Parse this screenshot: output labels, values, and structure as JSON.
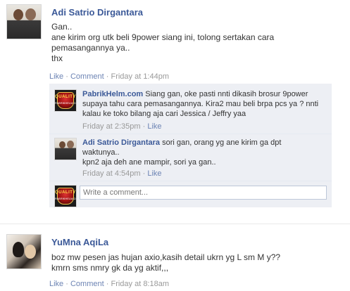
{
  "post1": {
    "author": "Adi Satrio Dirgantara",
    "lines": [
      "Gan..",
      "ane kirim org utk beli 9power siang ini, tolong sertakan cara",
      "pemasangannya ya..",
      "thx"
    ],
    "like": "Like",
    "sep1": "·",
    "comment": "Comment",
    "sep2": "·",
    "time": "Friday at 1:44pm"
  },
  "comment1": {
    "author": "PabrikHelm.com",
    "text_line1": "Siang gan, oke pasti nnti dikasih brosur 9power",
    "text_line2": "supaya tahu cara pemasangannya. Kira2 mau beli brpa pcs ya ? nnti",
    "text_line3": "kalau ke toko bilang aja cari Jessica / Jeffry yaa",
    "time": "Friday at 2:35pm",
    "sep": "·",
    "like": "Like",
    "logo_text": "QUALITY",
    "logo_sub": "PABRIKHELM.COM"
  },
  "comment2": {
    "author": "Adi Satrio Dirgantara",
    "text_line1": "sori gan, orang yg ane kirim ga dpt",
    "text_line2": "waktunya..",
    "text_line3": "kpn2 aja deh ane mampir, sori ya gan..",
    "time": "Friday at 4:54pm",
    "sep": "·",
    "like": "Like"
  },
  "write_comment": {
    "placeholder": "Write a comment..."
  },
  "post2": {
    "author": "YuMna AqiLa",
    "lines": [
      "boz mw pesen jas hujan axio,kasih detail ukrn yg L sm M y??",
      "kmrn sms nmry gk da yg aktif,,,"
    ],
    "like": "Like",
    "sep1": "·",
    "comment": "Comment",
    "sep2": "·",
    "time": "Friday at 8:18am"
  },
  "colors": {
    "link": "#3b5998",
    "meta_link": "#6d84b4",
    "comment_bg": "#edeff4"
  }
}
